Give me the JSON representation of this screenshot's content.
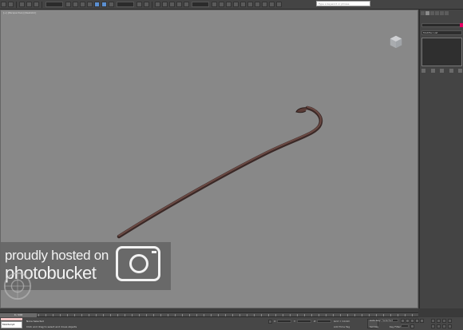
{
  "toolbar": {
    "search_placeholder": "Type a keyword or phrase"
  },
  "viewport": {
    "label": "[+] [Perspective] [Realistic]",
    "viewcube_icon": "viewcube-icon",
    "object": "curved-staff"
  },
  "watermark": {
    "line1": "proudly hosted on",
    "line2": "photobucket"
  },
  "command_panel": {
    "modifier_list": "Modifier List",
    "color_swatch": "#e60064"
  },
  "timeslider": {
    "frame": "0 / 100"
  },
  "statusbar": {
    "maxscript_label": "MAXScript",
    "selection_status": "None Selected",
    "prompt": "Click and drag to select and move objects",
    "x_label": "X:",
    "y_label": "Y:",
    "z_label": "Z:",
    "grid": "Grid = 10.0m",
    "add_time_tag": "Add Time Tag",
    "auto_key": "Auto Key",
    "set_key": "Set Key",
    "selected": "Selected",
    "key_filters": "Key Filters..."
  }
}
